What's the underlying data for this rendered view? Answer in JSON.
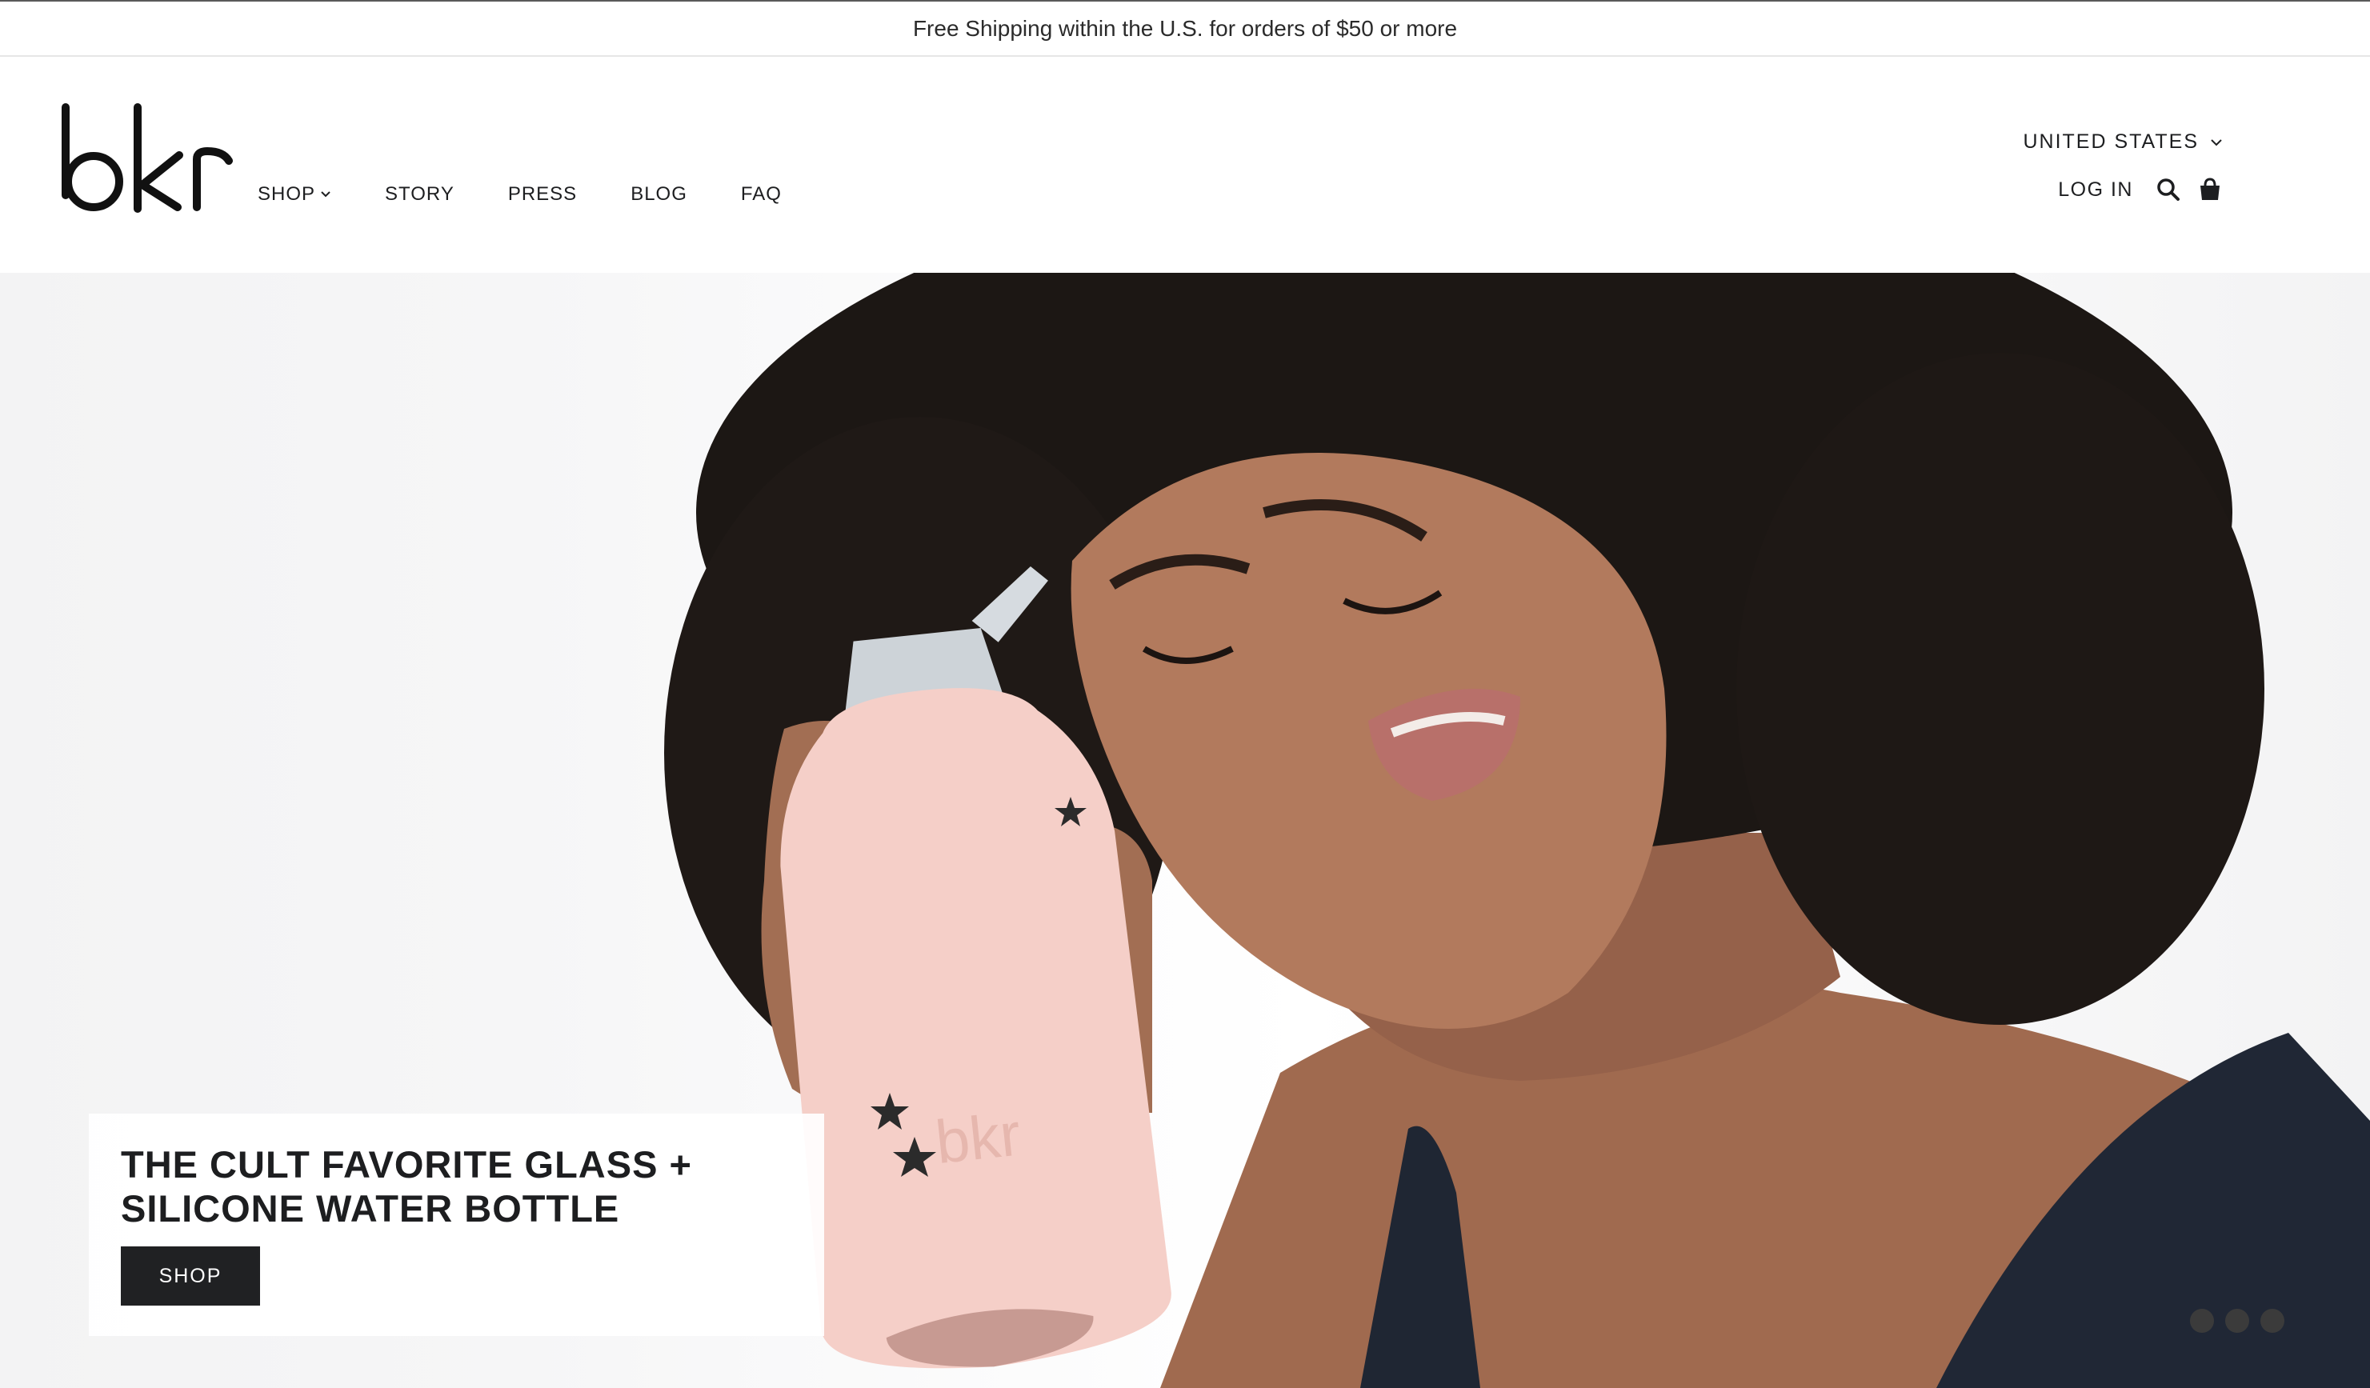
{
  "announcement": {
    "text": "Free Shipping within the U.S. for orders of $50 or more"
  },
  "header": {
    "logo_text": "bkr",
    "nav": [
      {
        "label": "SHOP",
        "has_dropdown": true
      },
      {
        "label": "STORY"
      },
      {
        "label": "PRESS"
      },
      {
        "label": "BLOG"
      },
      {
        "label": "FAQ"
      }
    ],
    "country_selector": "UNITED STATES",
    "login_label": "LOG IN",
    "icons": [
      "search-icon",
      "cart-icon",
      "chevron-down-icon"
    ]
  },
  "hero": {
    "headline": "THE CULT FAVORITE GLASS +\nSILICONE WATER BOTTLE",
    "cta_label": "SHOP",
    "bottle_logo": "bkr",
    "slides_count": 3,
    "active_slide": 1
  },
  "colors": {
    "text": "#1d1e20",
    "button_bg": "#202123",
    "button_text": "#ffffff",
    "bottle_pink": "#f5cfc8",
    "dot": "#3b3b3b"
  }
}
